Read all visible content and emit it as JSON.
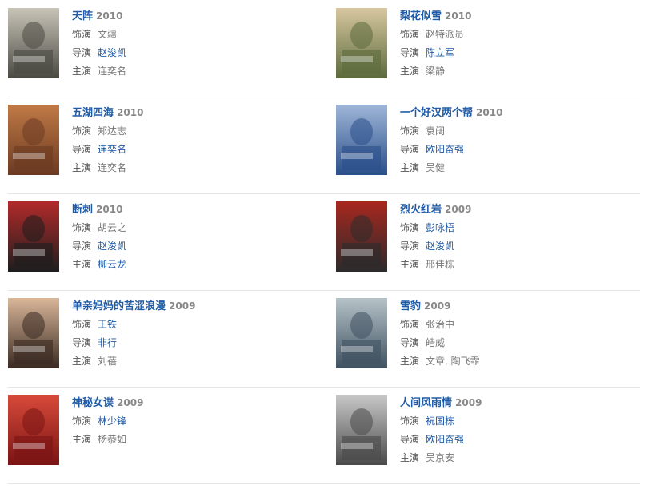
{
  "labels": {
    "role": "饰演",
    "director": "导演",
    "star": "主演"
  },
  "films": [
    {
      "title": "天阵",
      "year": "2010",
      "poster_icon": "poster-tianzhen-icon",
      "lines": [
        {
          "key": "role",
          "value": "文疆",
          "link": false
        },
        {
          "key": "director",
          "value": "赵浚凯",
          "link": true
        },
        {
          "key": "star",
          "value": "连奕名",
          "link": false
        }
      ],
      "poster_colors": [
        "#4a4a42",
        "#c9c4b8"
      ]
    },
    {
      "title": "梨花似雪",
      "year": "2010",
      "poster_icon": "poster-lihuasixue-icon",
      "lines": [
        {
          "key": "role",
          "value": "赵特派员",
          "link": false
        },
        {
          "key": "director",
          "value": "陈立军",
          "link": true
        },
        {
          "key": "star",
          "value": "梁静",
          "link": false
        }
      ],
      "poster_colors": [
        "#5b6a3c",
        "#d8c7a0"
      ]
    },
    {
      "title": "五湖四海",
      "year": "2010",
      "poster_icon": "poster-wuhusihai-icon",
      "lines": [
        {
          "key": "role",
          "value": "郑达志",
          "link": false
        },
        {
          "key": "director",
          "value": "连奕名",
          "link": true
        },
        {
          "key": "star",
          "value": "连奕名",
          "link": false
        }
      ],
      "poster_colors": [
        "#6b3a22",
        "#c07a46"
      ]
    },
    {
      "title": "一个好汉两个帮",
      "year": "2010",
      "poster_icon": "poster-yigehaohan-icon",
      "lines": [
        {
          "key": "role",
          "value": "袁阔",
          "link": false
        },
        {
          "key": "director",
          "value": "欧阳奋强",
          "link": true
        },
        {
          "key": "star",
          "value": "吴健",
          "link": false
        }
      ],
      "poster_colors": [
        "#2a4f8a",
        "#9fb6d8"
      ]
    },
    {
      "title": "断刺",
      "year": "2010",
      "poster_icon": "poster-duanci-icon",
      "lines": [
        {
          "key": "role",
          "value": "胡云之",
          "link": false
        },
        {
          "key": "director",
          "value": "赵浚凯",
          "link": true
        },
        {
          "key": "star",
          "value": "柳云龙",
          "link": true
        }
      ],
      "poster_colors": [
        "#1e1e1e",
        "#b22a2a"
      ]
    },
    {
      "title": "烈火红岩",
      "year": "2009",
      "poster_icon": "poster-liehuohongyan-icon",
      "lines": [
        {
          "key": "role",
          "value": "彭咏梧",
          "link": true
        },
        {
          "key": "director",
          "value": "赵浚凯",
          "link": true
        },
        {
          "key": "star",
          "value": "邢佳栋",
          "link": false
        }
      ],
      "poster_colors": [
        "#2b2b2b",
        "#a8271f"
      ]
    },
    {
      "title": "单亲妈妈的苦涩浪漫",
      "year": "2009",
      "poster_icon": "poster-danqinmama-icon",
      "lines": [
        {
          "key": "role",
          "value": "王铁",
          "link": true
        },
        {
          "key": "director",
          "value": "非行",
          "link": true
        },
        {
          "key": "star",
          "value": "刘蓓",
          "link": false
        }
      ],
      "poster_colors": [
        "#3a2a22",
        "#d9b79a"
      ]
    },
    {
      "title": "雪豹",
      "year": "2009",
      "poster_icon": "poster-xuebao-icon",
      "lines": [
        {
          "key": "role",
          "value": "张治中",
          "link": false
        },
        {
          "key": "director",
          "value": "皓威",
          "link": false
        },
        {
          "key": "star",
          "value": "文章, 陶飞霏",
          "link": false
        }
      ],
      "poster_colors": [
        "#3f5160",
        "#b5c2c8"
      ]
    },
    {
      "title": "神秘女谍",
      "year": "2009",
      "poster_icon": "poster-shenminudie-icon",
      "lines": [
        {
          "key": "role",
          "value": "林少锋",
          "link": true
        },
        {
          "key": "star",
          "value": "杨恭如",
          "link": false
        }
      ],
      "poster_colors": [
        "#7a1414",
        "#d84a3a"
      ]
    },
    {
      "title": "人间风雨情",
      "year": "2009",
      "poster_icon": "poster-renjianfengyu-icon",
      "lines": [
        {
          "key": "role",
          "value": "祝国栋",
          "link": true
        },
        {
          "key": "director",
          "value": "欧阳奋强",
          "link": true
        },
        {
          "key": "star",
          "value": "吴京安",
          "link": false
        }
      ],
      "poster_colors": [
        "#4a4a4a",
        "#c8c8c8"
      ]
    }
  ]
}
